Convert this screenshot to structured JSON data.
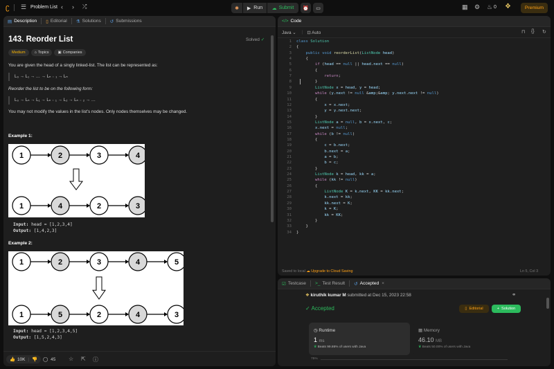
{
  "topbar": {
    "problem_list": "Problem List",
    "run": "Run",
    "submit": "Submit",
    "notif_count": "0",
    "premium": "Premium"
  },
  "left": {
    "tabs": [
      "Description",
      "Editorial",
      "Solutions",
      "Submissions"
    ],
    "title": "143. Reorder List",
    "solved": "Solved",
    "pills": [
      "Medium",
      "Topics",
      "Companies"
    ],
    "p1": "You are given the head of a singly linked-list. The list can be represented as:",
    "f1": "L₀ → L₁ → … → Lₙ ₋ ₁ → Lₙ",
    "p2": "Reorder the list to be on the following form:",
    "f2": "L₀ → Lₙ → L₁ → Lₙ ₋ ₁ → L₂ → Lₙ ₋ ₂ → …",
    "p3": "You may not modify the values in the list's nodes. Only nodes themselves may be changed.",
    "ex1": {
      "title": "Example 1:",
      "top": [
        "1",
        "2",
        "3",
        "4"
      ],
      "bottom": [
        "1",
        "4",
        "2",
        "3"
      ],
      "input_label": "Input:",
      "input": "head = [1,2,3,4]",
      "output_label": "Output:",
      "output": "[1,4,2,3]"
    },
    "ex2": {
      "title": "Example 2:",
      "top": [
        "1",
        "2",
        "3",
        "4",
        "5"
      ],
      "bottom": [
        "1",
        "5",
        "2",
        "4",
        "3"
      ],
      "input_label": "Input:",
      "input": "head = [1,2,3,4,5]",
      "output_label": "Output:",
      "output": "[1,5,2,4,3]"
    },
    "footer": {
      "likes": "10K",
      "comments": "45"
    }
  },
  "code": {
    "title": "Code",
    "lang": "Java",
    "auto": "Auto",
    "saved": "Saved to local",
    "upgrade": "Upgrade to Cloud Saving",
    "cursor": "Ln 5, Col 3",
    "lines": [
      "class Solution",
      "{",
      "    public void reorderList(ListNode head)",
      "    {",
      "        if (head == null || head.next == null)",
      "        {",
      "            return;",
      "        }",
      "        ListNode x = head, y = head;",
      "        while (y.next != null && y.next.next != null)",
      "        {",
      "            x = x.next;",
      "            y = y.next.next;",
      "        }",
      "        ListNode a = null, b = x.next, c;",
      "        x.next = null;",
      "        while (b != null)",
      "        {",
      "            c = b.next;",
      "            b.next = a;",
      "            a = b;",
      "            b = c;",
      "        }",
      "        ListNode k = head, kk = a;",
      "        while (kk != null)",
      "        {",
      "            ListNode K = k.next, KK = kk.next;",
      "            k.next = kk;",
      "            kk.next = K;",
      "            k = K;",
      "            kk = KK;",
      "        }",
      "    }",
      "}"
    ]
  },
  "result": {
    "tabs": [
      "Testcase",
      "Test Result",
      "Accepted"
    ],
    "user": "kiruthik kumar M",
    "submitted": "submitted at Dec 15, 2023 22:58",
    "status": "Accepted",
    "editorial": "Editorial",
    "solution": "Solution",
    "runtime_label": "Runtime",
    "runtime_val": "1",
    "runtime_unit": "ms",
    "runtime_beats": "Beats 99.86% of users with Java",
    "memory_label": "Memory",
    "memory_val": "46.10",
    "memory_unit": "MB",
    "memory_beats": "Beats 50.00% of users with Java",
    "axis_pct": "75%"
  }
}
